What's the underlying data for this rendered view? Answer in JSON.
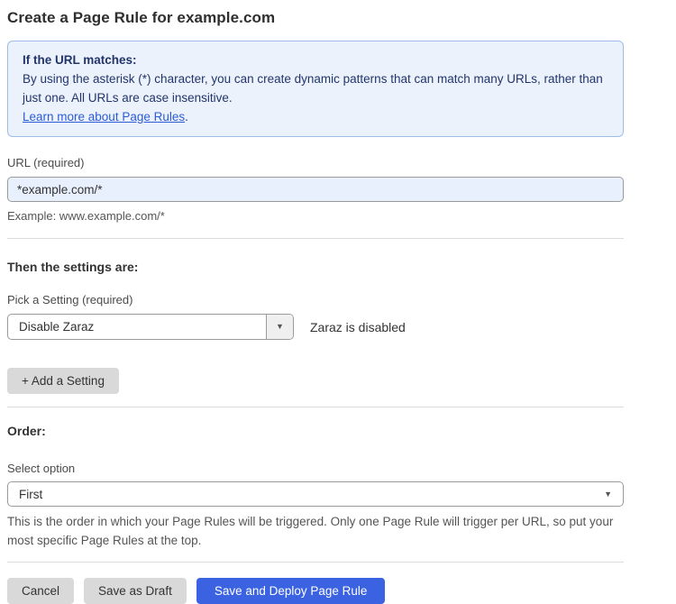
{
  "page": {
    "title": "Create a Page Rule for example.com"
  },
  "info_box": {
    "heading": "If the URL matches:",
    "body": "By using the asterisk (*) character, you can create dynamic patterns that can match many URLs, rather than just one. All URLs are case insensitive.",
    "link_label": "Learn more about Page Rules",
    "link_suffix": "."
  },
  "url_field": {
    "label": "URL (required)",
    "value": "*example.com/*",
    "help": "Example: www.example.com/*"
  },
  "settings_section": {
    "heading": "Then the settings are:",
    "picker_label": "Pick a Setting (required)",
    "picker_value": "Disable Zaraz",
    "status_text": "Zaraz is disabled",
    "add_button_label": "+ Add a Setting"
  },
  "order_section": {
    "heading": "Order:",
    "select_label": "Select option",
    "select_value": "First",
    "help": "This is the order in which your Page Rules will be triggered. Only one Page Rule will trigger per URL, so put your most specific Page Rules at the top."
  },
  "actions": {
    "cancel_label": "Cancel",
    "save_draft_label": "Save as Draft",
    "deploy_label": "Save and Deploy Page Rule"
  },
  "colors": {
    "info_box_bg": "#ecf2fc",
    "info_box_border": "#9fbce8",
    "info_text": "#22356b",
    "link": "#2c5cd5",
    "url_input_bg": "#e8f0fe",
    "primary_button_bg": "#3b63e1",
    "gray_button_bg": "#d9d9d9"
  }
}
